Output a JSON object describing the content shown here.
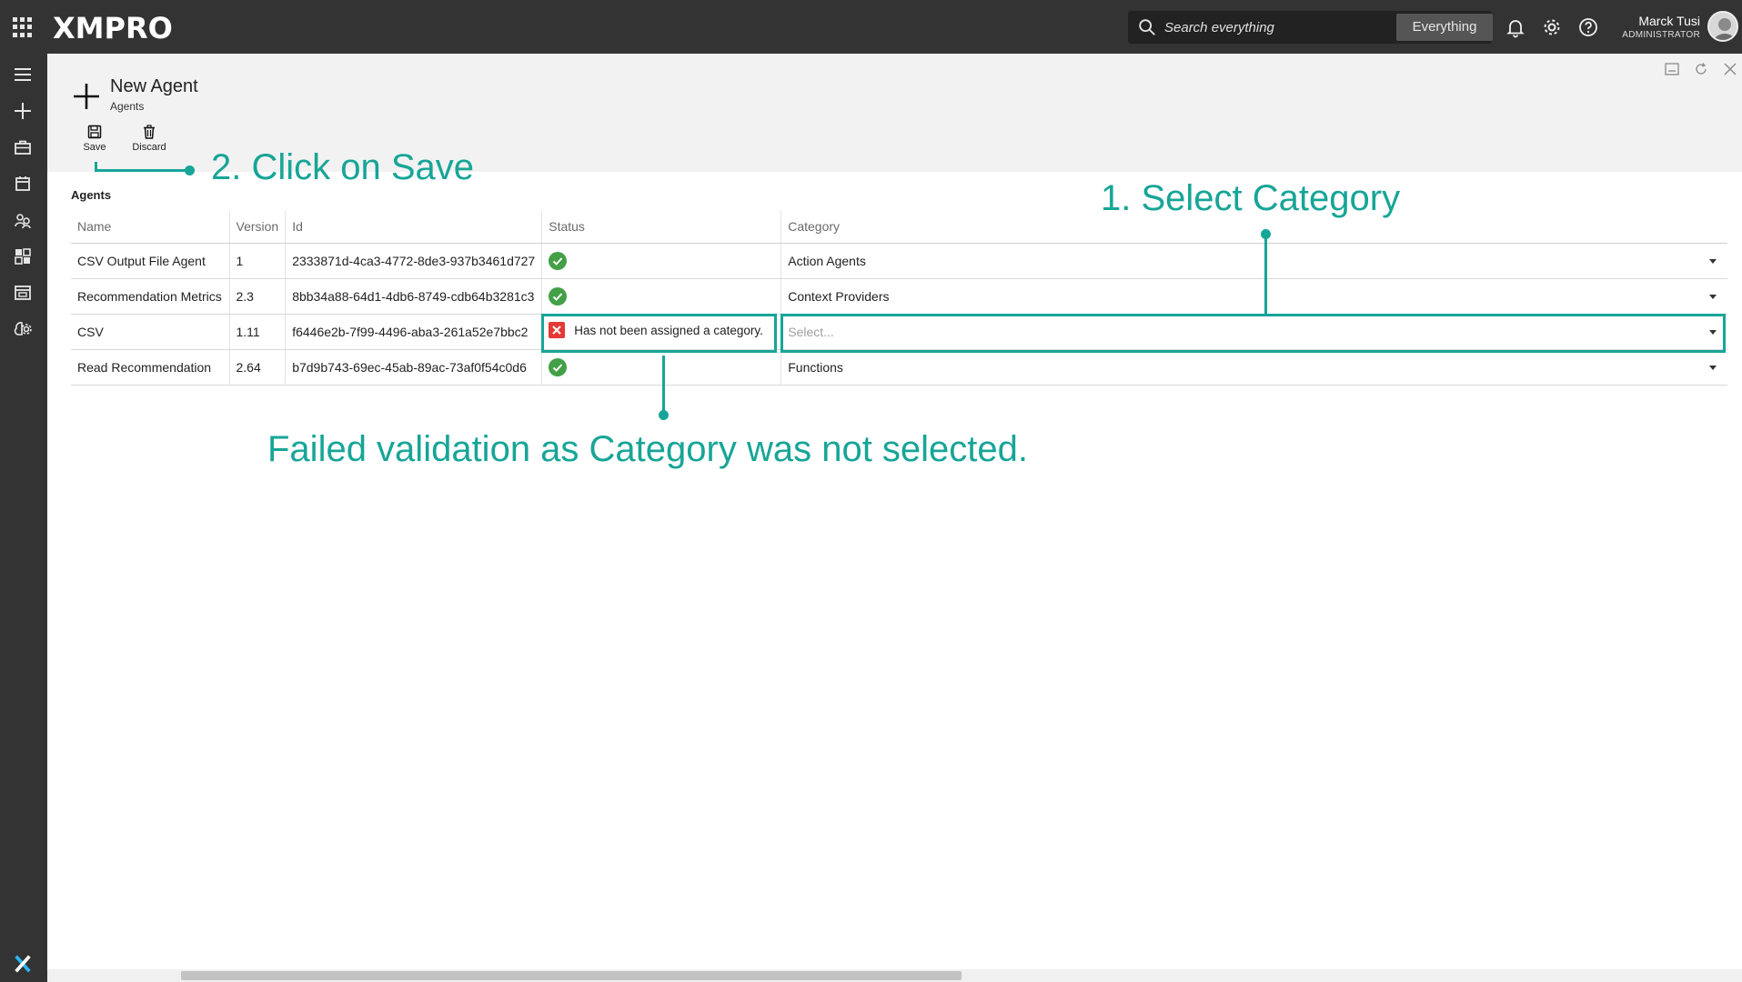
{
  "app": {
    "brand": "XMPRO"
  },
  "search": {
    "placeholder": "Search everything",
    "scope": "Everything"
  },
  "user": {
    "name": "Marck Tusi",
    "role": "ADMINISTRATOR"
  },
  "icons": {
    "apps": "apps-grid-icon",
    "search": "search-icon",
    "bell": "bell-icon",
    "settings": "gear-icon",
    "help": "help-icon",
    "nav": [
      "menu-icon",
      "plus-icon",
      "briefcase-icon",
      "calendar-icon",
      "agents-icon",
      "dashboard-icon",
      "window-icon",
      "brain-gear-icon"
    ]
  },
  "page": {
    "title": "New Agent",
    "subtitle": "Agents"
  },
  "toolbar": {
    "save_label": "Save",
    "discard_label": "Discard"
  },
  "grid": {
    "title": "Agents",
    "columns": [
      "Name",
      "Version",
      "Id",
      "Status",
      "Category"
    ],
    "rows": [
      {
        "name": "CSV Output File Agent",
        "version": "1",
        "id": "2333871d-4ca3-4772-8de3-937b3461d727",
        "status": "ok",
        "status_text": "",
        "category": "Action Agents"
      },
      {
        "name": "Recommendation Metrics",
        "version": "2.3",
        "id": "8bb34a88-64d1-4db6-8749-cdb64b3281c3",
        "status": "ok",
        "status_text": "",
        "category": "Context Providers"
      },
      {
        "name": "CSV",
        "version": "1.11",
        "id": "f6446e2b-7f99-4496-aba3-261a52e7bbc2",
        "status": "error",
        "status_text": "Has not been assigned a category.",
        "category": "Select..."
      },
      {
        "name": "Read Recommendation",
        "version": "2.64",
        "id": "b7d9b743-69ec-45ab-89ac-73af0f54c0d6",
        "status": "ok",
        "status_text": "",
        "category": "Functions"
      }
    ]
  },
  "annotations": {
    "step1": "1.    Select Category",
    "step2": "2. Click on Save",
    "note": "Failed validation as Category was not selected."
  },
  "colors": {
    "topbar": "#333333",
    "accent": "#17a597",
    "ok": "#43a047",
    "error": "#e53935"
  }
}
